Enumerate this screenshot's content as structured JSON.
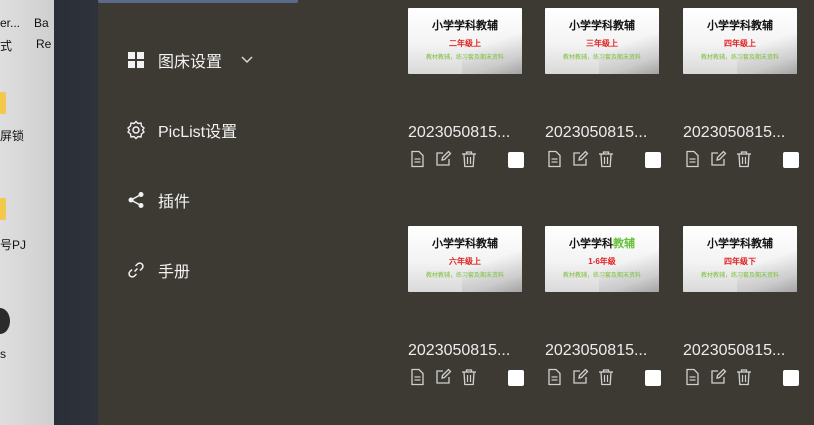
{
  "desktop": {
    "items": [
      "er...",
      "Ba",
      "式",
      "Re",
      "屏锁",
      "号PJ",
      "s"
    ]
  },
  "sidebar": {
    "items": [
      {
        "label": "图床设置",
        "icon": "grid-icon",
        "has_chevron": true
      },
      {
        "label": "PicList设置",
        "icon": "gear-icon",
        "has_chevron": false
      },
      {
        "label": "插件",
        "icon": "share-icon",
        "has_chevron": false
      },
      {
        "label": "手册",
        "icon": "link-icon",
        "has_chevron": false
      }
    ]
  },
  "gallery": {
    "cards": [
      {
        "filename": "2023050815...",
        "thumb_title": "小学学科教辅",
        "thumb_accent": "",
        "grade": "二年级上",
        "subtitle": "教材教辅，练习套及期末资料"
      },
      {
        "filename": "2023050815...",
        "thumb_title": "小学学科教辅",
        "thumb_accent": "",
        "grade": "三年级上",
        "subtitle": "教材教辅，练习套及期末资料"
      },
      {
        "filename": "2023050815...",
        "thumb_title": "小学学科教辅",
        "thumb_accent": "",
        "grade": "四年级上",
        "subtitle": "教材教辅，练习套及期末资料"
      },
      {
        "filename": "2023050815...",
        "thumb_title": "小学学科教辅",
        "thumb_accent": "",
        "grade": "六年级上",
        "subtitle": "教材教辅，练习套及期末资料"
      },
      {
        "filename": "2023050815...",
        "thumb_title": "小学学科",
        "thumb_accent": "教辅",
        "grade": "1-6年级",
        "subtitle": "教材教辅，练习套及期末资料"
      },
      {
        "filename": "2023050815...",
        "thumb_title": "小学学科教辅",
        "thumb_accent": "",
        "grade": "四年级下",
        "subtitle": "教材教辅，练习套及期末资料"
      }
    ]
  },
  "colors": {
    "background": "#3d3a33",
    "accent_green": "#67c23a",
    "grade_red": "#e02020"
  }
}
